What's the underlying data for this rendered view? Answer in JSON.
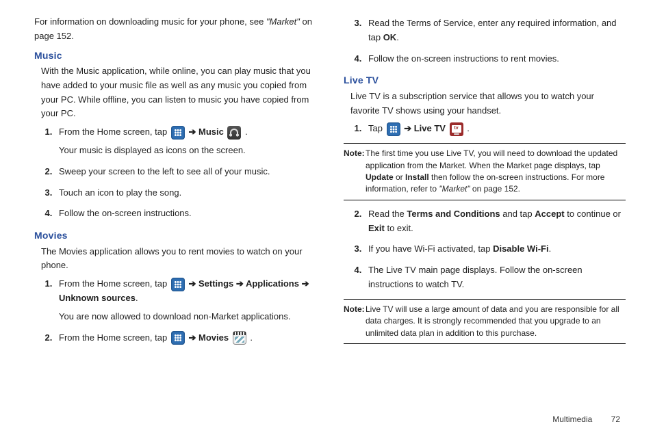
{
  "left": {
    "intro_pre": "For information on downloading music for your phone, see ",
    "intro_link": "\"Market\"",
    "intro_post": " on page 152.",
    "music_heading": "Music",
    "music_para": "With the Music application, while online, you can play music that you have added to your music file as well as any music you copied from your PC. While offline, you can listen to music you have copied from your PC.",
    "music_step1_pre": "From the Home screen, tap ",
    "arrow": " ➔ ",
    "music_label": "Music",
    "music_step1_post": " .",
    "music_step1_sub": "Your music is displayed as icons on the screen.",
    "music_step2": "Sweep your screen to the left to see all of your music.",
    "music_step3": "Touch an icon to play the song.",
    "music_step4": "Follow the on-screen instructions.",
    "movies_heading": "Movies",
    "movies_para": "The Movies application allows you to rent movies to watch on your phone.",
    "movies_step1_pre": "From the Home screen, tap ",
    "settings_label": "Settings",
    "applications_label": "Applications",
    "unknown_label": "Unknown sources",
    "movies_step1_sub": "You are now allowed to download non-Market applications.",
    "movies_step2_pre": "From the Home screen, tap ",
    "movies_label": "Movies"
  },
  "right": {
    "step3_pre": "Read the Terms of Service, enter any required information, and tap ",
    "ok_label": "OK",
    "step4": "Follow the on-screen instructions to rent movies.",
    "livetv_heading": "Live TV",
    "livetv_para": "Live TV is a subscription service that allows you to watch your favorite TV shows using your handset.",
    "livetv_step1_pre": "Tap ",
    "arrow": " ➔ ",
    "livetv_label": "Live TV",
    "note1_label": "Note:",
    "note1_pre": " The first time you use Live TV, you will need to download the updated application from the Market. When the Market page displays, tap ",
    "update_label": "Update",
    "or_label": " or ",
    "install_label": "Install",
    "note1_mid": " then follow the on-screen instructions. For more information, refer to ",
    "note1_link": "\"Market\"",
    "note1_post": "  on page 152.",
    "step2_pre": "Read the ",
    "terms_label": "Terms and Conditions",
    "step2_mid": " and tap ",
    "accept_label": "Accept",
    "step2_mid2": " to continue or ",
    "exit_label": "Exit",
    "step2_post": " to exit.",
    "step3b_pre": "If you have Wi-Fi activated, tap ",
    "disable_label": "Disable Wi-Fi",
    "step4b": "The Live TV main page displays. Follow the on-screen instructions to watch TV.",
    "note2_label": "Note:",
    "note2_body": " Live TV will use a large amount of data and you are responsible for all data charges. It is strongly recommended that you upgrade to an unlimited data plan in addition to this purchase."
  },
  "footer": {
    "section": "Multimedia",
    "page": "72"
  }
}
